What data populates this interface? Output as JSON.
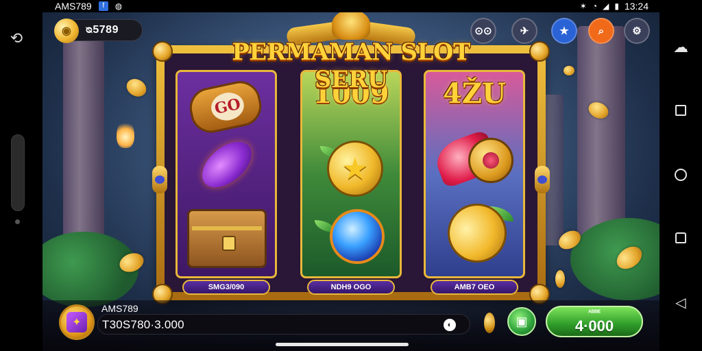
{
  "status_bar": {
    "app_label": "AMS789",
    "time": "13:24"
  },
  "hud": {
    "balance": "ᴓ5789",
    "buttons": [
      {
        "name": "menu",
        "label": "⊙⊙",
        "color": "#3a3f5a"
      },
      {
        "name": "plane",
        "label": "✈",
        "color": "#3a3f5a"
      },
      {
        "name": "favorite",
        "label": "★",
        "color": "#2a63d6"
      },
      {
        "name": "search",
        "label": "⌕",
        "color": "#f06a1a"
      },
      {
        "name": "settings",
        "label": "⚙",
        "color": "#3a3f5a"
      }
    ]
  },
  "title": "PERMAMAN SLOT SERU",
  "reels": [
    {
      "top_label": "",
      "name": "SMG3/090"
    },
    {
      "top_label": "1009",
      "name": "NDH9 OGO"
    },
    {
      "top_label": "4ŽU",
      "name": "AMB7 OEO"
    }
  ],
  "reel1_barrel_text": "GO",
  "bottom": {
    "player_name": "AMS789",
    "bet_value": "T30S780·3.000",
    "spin_small": "ᴬᴮᴮᴱ",
    "spin_value": "4·000"
  },
  "colors": {
    "accent_gold": "#f0c13e",
    "spin_green": "#2f9d2a",
    "panel_purple": "#3e1864"
  }
}
